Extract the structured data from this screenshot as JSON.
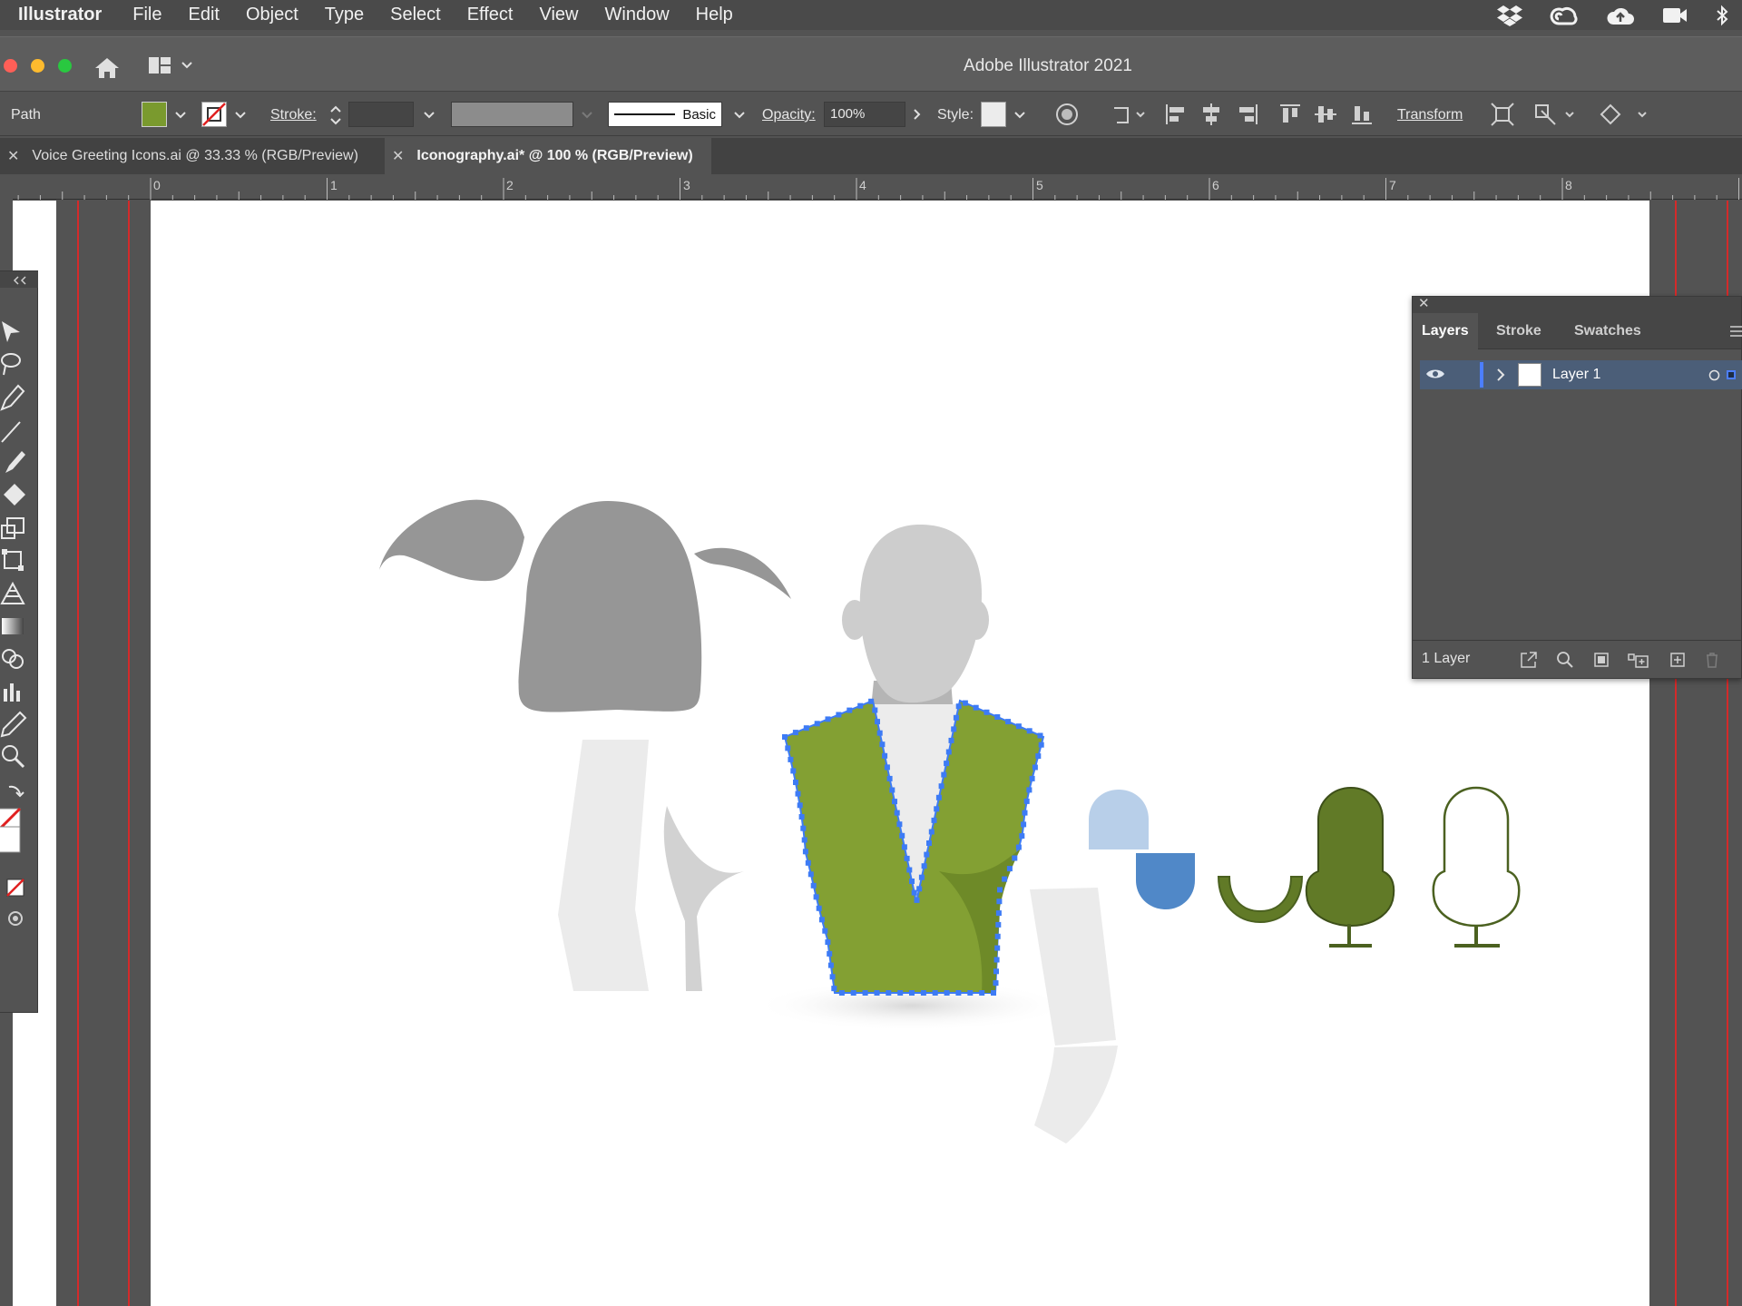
{
  "menubar": {
    "app_name": "Illustrator",
    "items": [
      "File",
      "Edit",
      "Object",
      "Type",
      "Select",
      "Effect",
      "View",
      "Window",
      "Help"
    ],
    "status_icons": [
      "dropbox-icon",
      "creative-cloud-icon",
      "cloud-upload-icon",
      "camera-icon",
      "bluetooth-icon"
    ]
  },
  "window": {
    "title": "Adobe Illustrator 2021"
  },
  "controlbar": {
    "selection_type": "Path",
    "fill_color": "#7a9a2e",
    "stroke_label": "Stroke:",
    "brush_label": "Basic",
    "opacity_label": "Opacity:",
    "opacity_value": "100%",
    "style_label": "Style:",
    "transform_label": "Transform"
  },
  "tabs": [
    {
      "label": "Voice Greeting Icons.ai @ 33.33 % (RGB/Preview)",
      "active": false
    },
    {
      "label": "Iconography.ai* @ 100 % (RGB/Preview)",
      "active": true
    }
  ],
  "ruler": {
    "labels": [
      "0",
      "1",
      "2",
      "3",
      "4",
      "5",
      "6",
      "7",
      "8"
    ]
  },
  "layers_panel": {
    "tabs": [
      "Layers",
      "Stroke",
      "Swatches"
    ],
    "layers": [
      {
        "name": "Layer 1"
      }
    ],
    "footer_count": "1 Layer"
  },
  "colors": {
    "vest_green": "#83a033",
    "mic_dark_green": "#617a27",
    "mic_outline": "#4b6120",
    "selection_blue": "#3d7bf5",
    "guide_red": "#d42a2a",
    "light_blue": "#b8cfe9",
    "mid_blue": "#5088c8"
  },
  "tools": [
    "selection-tool-icon",
    "lasso-tool-icon",
    "pen-tool-icon",
    "line-tool-icon",
    "brush-tool-icon",
    "eraser-tool-icon",
    "scale-tool-icon",
    "free-transform-icon",
    "perspective-grid-icon",
    "gradient-tool-icon",
    "shape-builder-icon",
    "graph-tool-icon",
    "eyedropper-tool-icon",
    "zoom-tool-icon",
    "swap-fill-stroke-icon",
    "fill-stroke-icon",
    "none-icon",
    "draw-mode-icon"
  ]
}
